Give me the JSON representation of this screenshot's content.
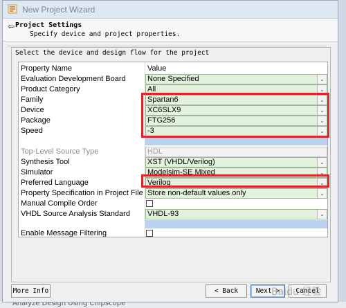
{
  "window": {
    "title": "New Project Wizard"
  },
  "header": {
    "title": "Project Settings",
    "subtitle": "Specify device and project properties."
  },
  "group": {
    "label": "Select the device and design flow for the project"
  },
  "table": {
    "col_property": "Property Name",
    "col_value": "Value",
    "rows": [
      {
        "label": "Evaluation Development Board",
        "value": "None Specified"
      },
      {
        "label": "Product Category",
        "value": "All"
      },
      {
        "label": "Family",
        "value": "Spartan6"
      },
      {
        "label": "Device",
        "value": "XC6SLX9"
      },
      {
        "label": "Package",
        "value": "FTG256"
      },
      {
        "label": "Speed",
        "value": "-3"
      },
      {
        "label": "Top-Level Source Type",
        "value": "HDL"
      },
      {
        "label": "Synthesis Tool",
        "value": "XST (VHDL/Verilog)"
      },
      {
        "label": "Simulator",
        "value": "Modelsim-SE Mixed"
      },
      {
        "label": "Preferred Language",
        "value": "Verilog"
      },
      {
        "label": "Property Specification in Project File",
        "value": "Store non-default values only"
      },
      {
        "label": "Manual Compile Order",
        "value": ""
      },
      {
        "label": "VHDL Source Analysis Standard",
        "value": "VHDL-93"
      },
      {
        "label": "Enable Message Filtering",
        "value": ""
      }
    ]
  },
  "buttons": {
    "more_info": "More Info",
    "back": "< Back",
    "next": "Next >",
    "cancel": "Cancel"
  },
  "background": {
    "partial_text": "Analyze Design Using Chipscope"
  },
  "watermark": "Baidu 经验",
  "colors": {
    "highlight_box": "#e0242c",
    "value_cell": "#e2f2dc",
    "selection_band": "#b9d3ee"
  }
}
